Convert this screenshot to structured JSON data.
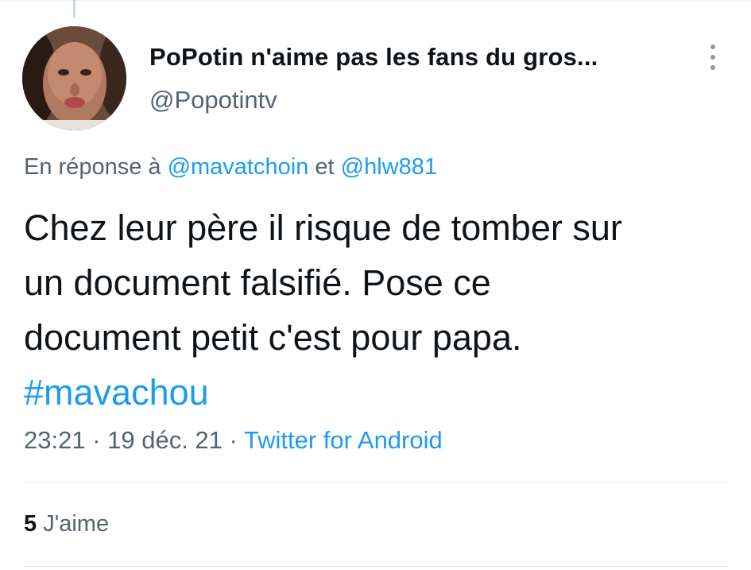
{
  "tweet": {
    "author": {
      "display_name": "PoPotin n'aime pas les fans du gros...",
      "handle": "@Popotintv"
    },
    "reply_to": {
      "prefix": "En réponse à ",
      "first_mention": "@mavatchoin",
      "joiner": " et ",
      "second_mention": "@hlw881"
    },
    "text_lines": [
      "Chez leur père il risque de tomber sur",
      "un document falsifié. Pose ce",
      "document petit c'est pour papa."
    ],
    "hashtag": "#mavachou",
    "timestamp": "23:21 · 19 déc. 21 · ",
    "source": "Twitter for Android",
    "likes": {
      "count": "5",
      "label": " J'aime"
    }
  },
  "icons": {
    "more": "more-vertical-icon",
    "avatar": "profile-avatar"
  },
  "colors": {
    "link": "#1d9bf0",
    "secondary_text": "#536471",
    "primary_text": "#0f1419",
    "divider": "#e6ecf0"
  }
}
